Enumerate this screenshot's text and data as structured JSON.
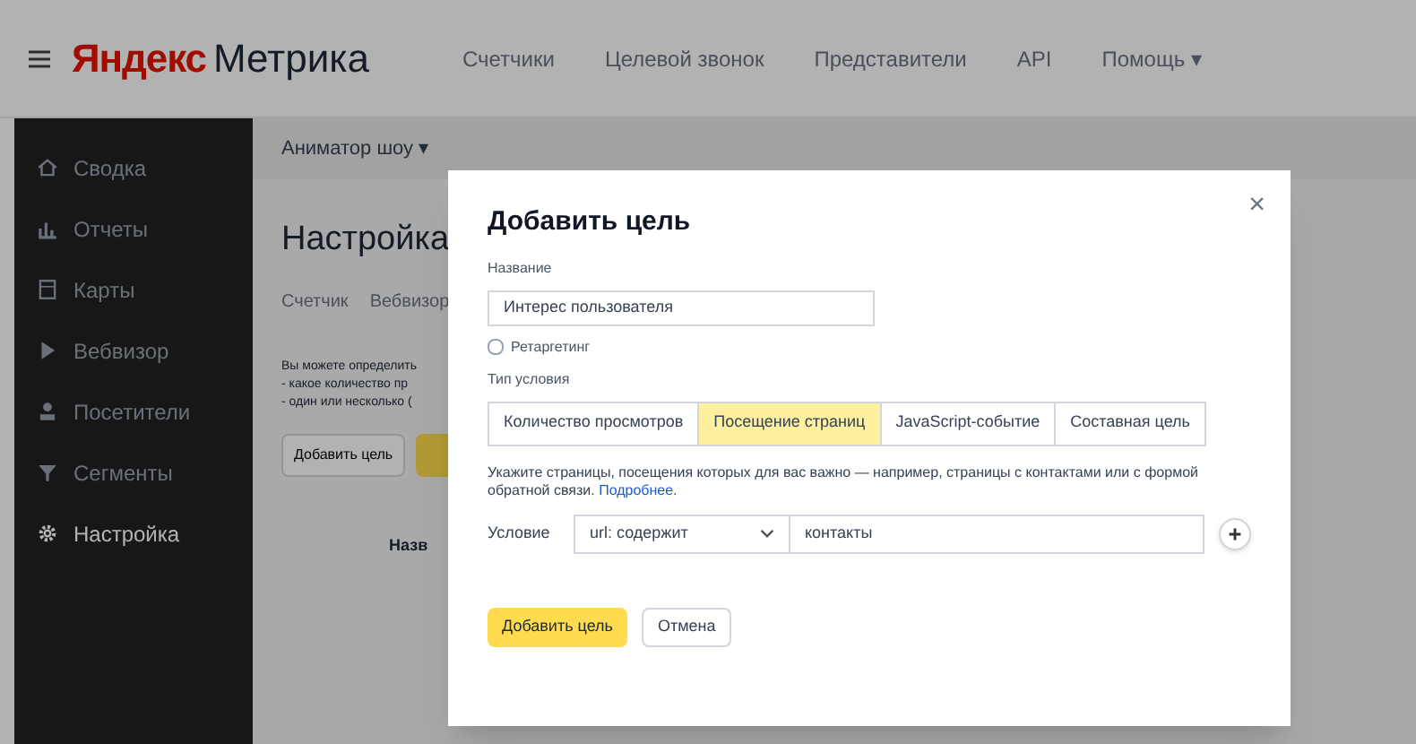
{
  "header": {
    "logo_brand": "Яндекс",
    "logo_product": "Метрика",
    "nav": [
      "Счетчики",
      "Целевой звонок",
      "Представители",
      "API",
      "Помощь ▾"
    ]
  },
  "sidebar": {
    "items": [
      {
        "label": "Сводка",
        "selected": false
      },
      {
        "label": "Отчеты",
        "selected": false
      },
      {
        "label": "Карты",
        "selected": false
      },
      {
        "label": "Вебвизор",
        "selected": false
      },
      {
        "label": "Посетители",
        "selected": false
      },
      {
        "label": "Сегменты",
        "selected": false
      },
      {
        "label": "Настройка",
        "selected": true
      }
    ]
  },
  "breadcrumb": "Аниматор шоу ▾",
  "page": {
    "title": "Настройка",
    "tabs": [
      "Счетчик",
      "Вебвизор"
    ],
    "description_lines": [
      "Вы можете определить",
      "- какое количество пр",
      "- один или несколько ("
    ],
    "add_goal_button": "Добавить цель",
    "column_header": "Назв"
  },
  "dialog": {
    "title": "Добавить цель",
    "close": "×",
    "name_label": "Название",
    "name_value": "Интерес пользователя",
    "retargeting": {
      "label": "Ретаргетинг",
      "checked": false
    },
    "type_label": "Тип условия",
    "types": [
      {
        "label": "Количество просмотров",
        "selected": false
      },
      {
        "label": "Посещение страниц",
        "selected": true
      },
      {
        "label": "JavaScript-событие",
        "selected": false
      },
      {
        "label": "Составная цель",
        "selected": false
      }
    ],
    "hint": "Укажите страницы, посещения которых для вас важно — например, страницы с контактами или с формой обратной связи.",
    "hint_link": "Подробнее.",
    "condition_label": "Условие",
    "condition_operator": "url: содержит",
    "condition_value": "контакты",
    "submit": "Добавить цель",
    "cancel": "Отмена"
  }
}
